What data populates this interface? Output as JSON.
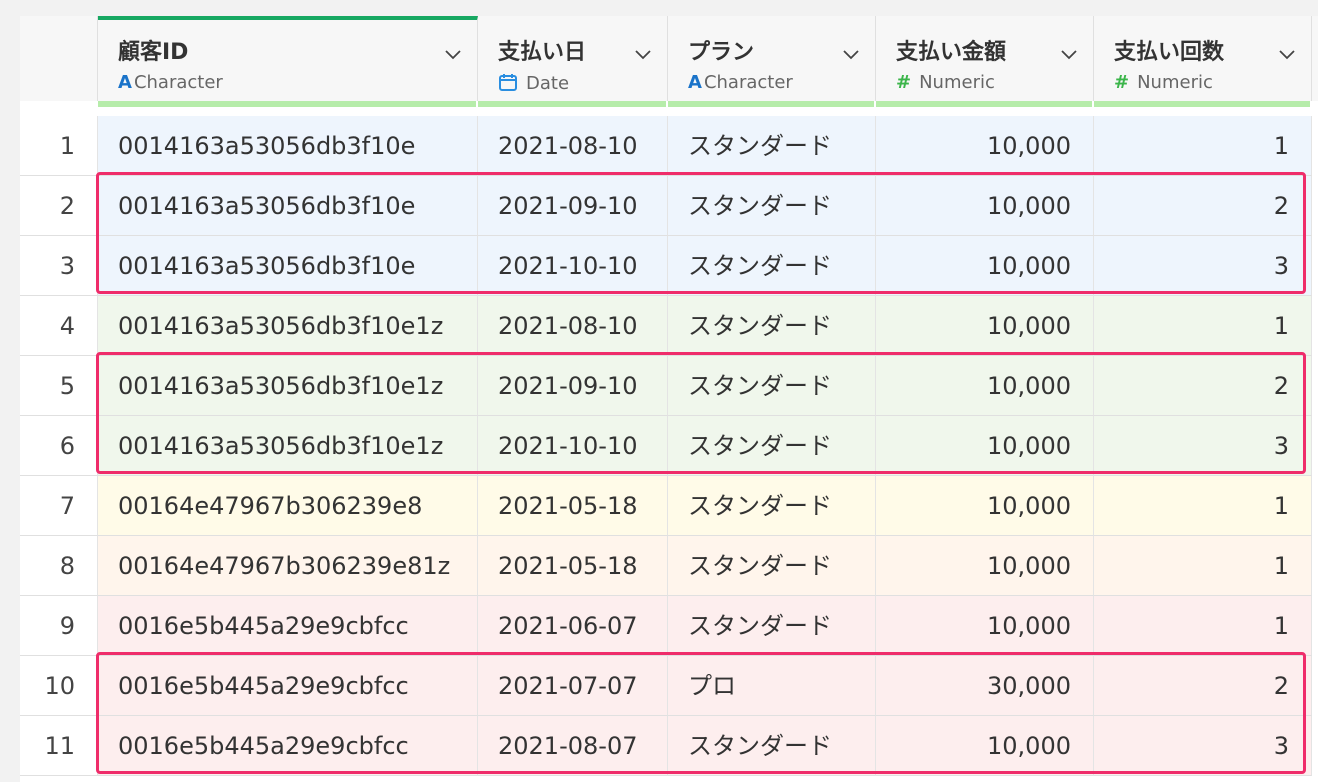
{
  "columns": [
    {
      "name": "顧客ID",
      "type": "Character",
      "type_icon": "A"
    },
    {
      "name": "支払い日",
      "type": "Date",
      "type_icon": "calendar-icon"
    },
    {
      "name": "プラン",
      "type": "Character",
      "type_icon": "A"
    },
    {
      "name": "支払い金額",
      "type": "Numeric",
      "type_icon": "#"
    },
    {
      "name": "支払い回数",
      "type": "Numeric",
      "type_icon": "#"
    }
  ],
  "rows": [
    {
      "n": "1",
      "id": "0014163a53056db3f10e",
      "date": "2021-08-10",
      "plan": "スタンダード",
      "amount": "10,000",
      "count": "1"
    },
    {
      "n": "2",
      "id": "0014163a53056db3f10e",
      "date": "2021-09-10",
      "plan": "スタンダード",
      "amount": "10,000",
      "count": "2"
    },
    {
      "n": "3",
      "id": "0014163a53056db3f10e",
      "date": "2021-10-10",
      "plan": "スタンダード",
      "amount": "10,000",
      "count": "3"
    },
    {
      "n": "4",
      "id": "0014163a53056db3f10e1z",
      "date": "2021-08-10",
      "plan": "スタンダード",
      "amount": "10,000",
      "count": "1"
    },
    {
      "n": "5",
      "id": "0014163a53056db3f10e1z",
      "date": "2021-09-10",
      "plan": "スタンダード",
      "amount": "10,000",
      "count": "2"
    },
    {
      "n": "6",
      "id": "0014163a53056db3f10e1z",
      "date": "2021-10-10",
      "plan": "スタンダード",
      "amount": "10,000",
      "count": "3"
    },
    {
      "n": "7",
      "id": "00164e47967b306239e8",
      "date": "2021-05-18",
      "plan": "スタンダード",
      "amount": "10,000",
      "count": "1"
    },
    {
      "n": "8",
      "id": "00164e47967b306239e81z",
      "date": "2021-05-18",
      "plan": "スタンダード",
      "amount": "10,000",
      "count": "1"
    },
    {
      "n": "9",
      "id": "0016e5b445a29e9cbfcc",
      "date": "2021-06-07",
      "plan": "スタンダード",
      "amount": "10,000",
      "count": "1"
    },
    {
      "n": "10",
      "id": "0016e5b445a29e9cbfcc",
      "date": "2021-07-07",
      "plan": "プロ",
      "amount": "30,000",
      "count": "2"
    },
    {
      "n": "11",
      "id": "0016e5b445a29e9cbfcc",
      "date": "2021-08-07",
      "plan": "スタンダード",
      "amount": "10,000",
      "count": "3"
    }
  ],
  "colors": {
    "character_icon": "#1a73c9",
    "date_icon": "#2a8ee0",
    "numeric_icon": "#3bb54a",
    "active_column_bar": "#17a862",
    "quality_bar": "#b6ecaa",
    "highlight_border": "#ef2c6a",
    "group_backgrounds": [
      "#eef5fd",
      "#f0f7ec",
      "#fffbe8",
      "#fff5ec",
      "#fdeeee"
    ]
  },
  "highlight_groups": [
    [
      2,
      3
    ],
    [
      5,
      6
    ],
    [
      10,
      11
    ]
  ],
  "active_column": 0
}
